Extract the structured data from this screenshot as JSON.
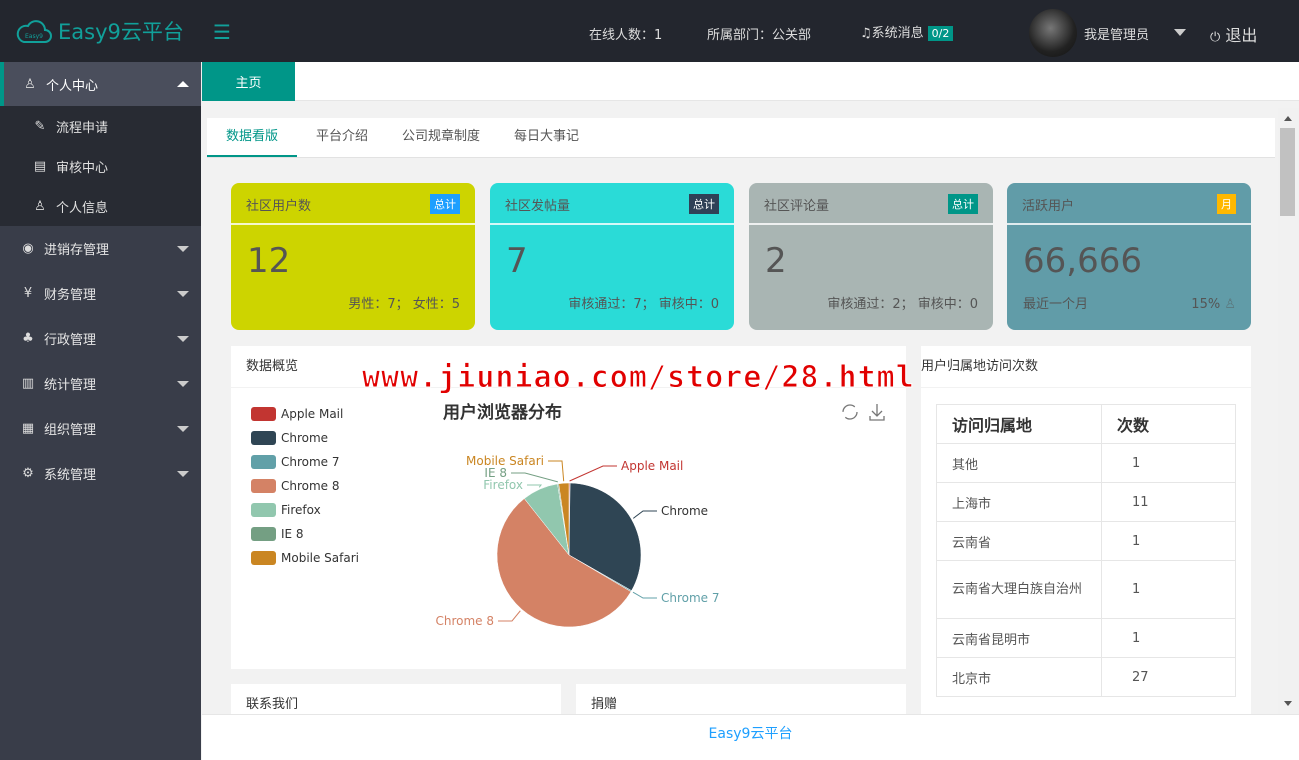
{
  "header": {
    "app_title": "Easy9云平台",
    "logo_text": "Easy9",
    "online": "在线人数：1",
    "department": "所属部门：公关部",
    "messages_label": "系统消息",
    "messages_badge": "0/2",
    "user": "我是管理员",
    "logout": "退出"
  },
  "sidebar": {
    "active_group": "个人中心",
    "sub_items": [
      "流程申请",
      "审核中心",
      "个人信息"
    ],
    "groups": [
      "进销存管理",
      "财务管理",
      "行政管理",
      "统计管理",
      "组织管理",
      "系统管理"
    ]
  },
  "tabs": {
    "home": "主页"
  },
  "inner_tabs": [
    "数据看版",
    "平台介绍",
    "公司规章制度",
    "每日大事记"
  ],
  "cards": [
    {
      "title": "社区用户数",
      "tag": "总计",
      "value": "12",
      "footer": "男性：7； 女性：5",
      "color": "#cdd400",
      "tag_color": "#1e9fff"
    },
    {
      "title": "社区发帖量",
      "tag": "总计",
      "value": "7",
      "footer": "审核通过：7； 审核中：0",
      "color": "#2adbd7",
      "tag_color": "#2f4056"
    },
    {
      "title": "社区评论量",
      "tag": "总计",
      "value": "2",
      "footer": "审核通过：2； 审核中：0",
      "color": "#a9b5b3",
      "tag_color": "#009688"
    },
    {
      "title": "活跃用户",
      "tag": "月",
      "value": "66,666",
      "footer_left": "最近一个月",
      "footer": "15%",
      "color": "#619ca8",
      "tag_color": "#ffb800"
    }
  ],
  "overview": {
    "title": "数据概览"
  },
  "chart_data": {
    "type": "pie",
    "title": "用户浏览器分布",
    "categories": [
      "Apple Mail",
      "Chrome",
      "Chrome 7",
      "Chrome 8",
      "Firefox",
      "IE 8",
      "Mobile Safari"
    ],
    "values": [
      1,
      130,
      1,
      220,
      32,
      1,
      9
    ],
    "colors": [
      "#c23531",
      "#2f4554",
      "#61a0a8",
      "#d48265",
      "#91c7ae",
      "#749f83",
      "#ca8622"
    ],
    "legend": "left"
  },
  "visits": {
    "title": "用户归属地访问次数",
    "headers": [
      "访问归属地",
      "次数"
    ],
    "rows": [
      [
        "其他",
        "1"
      ],
      [
        "上海市",
        "11"
      ],
      [
        "云南省",
        "1"
      ],
      [
        "云南省大理白族自治州",
        "1"
      ],
      [
        "云南省昆明市",
        "1"
      ],
      [
        "北京市",
        "27"
      ]
    ]
  },
  "contact": {
    "title": "联系我们"
  },
  "donate": {
    "title": "捐赠"
  },
  "footer": {
    "text": "Easy9云平台"
  },
  "watermark": "www.jiuniao.com/store/28.html"
}
